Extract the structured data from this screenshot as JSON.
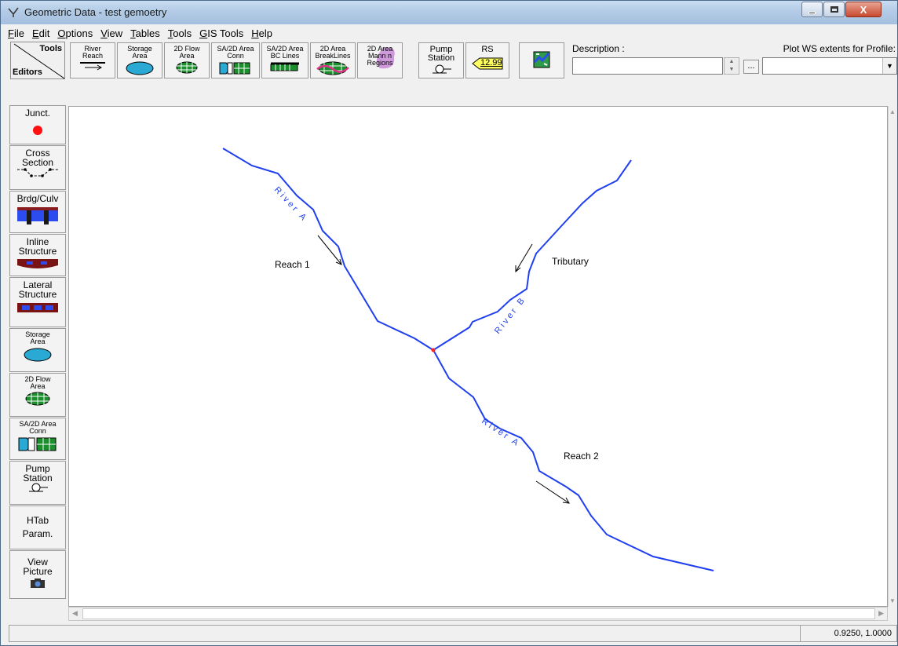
{
  "window": {
    "title": "Geometric Data - test gemoetry",
    "close_glyph": "X"
  },
  "menu": [
    {
      "label": "File"
    },
    {
      "label": "Edit"
    },
    {
      "label": "Options"
    },
    {
      "label": "View"
    },
    {
      "label": "Tables"
    },
    {
      "label": "Tools"
    },
    {
      "label": "GIS Tools"
    },
    {
      "label": "Help"
    }
  ],
  "toolbar": {
    "corner_tools": "Tools",
    "corner_editors": "Editors",
    "river_reach": "River\nReach",
    "storage_area": "Storage\nArea",
    "flow_area_2d": "2D Flow\nArea",
    "sa2d_conn": "SA/2D Area\nConn",
    "sa2d_bc": "SA/2D Area\nBC Lines",
    "breaklines_2d": "2D Area\nBreakLines",
    "mann_regions_2d": "2D Area\nMann n\nRegions",
    "pump_station": "Pump\nStation",
    "rs": "RS",
    "rs_value": "12.99",
    "description_label": "Description :",
    "description_value": "",
    "ellipsis": "...",
    "plot_ws_label": "Plot WS extents for Profile:",
    "plot_ws_value": ""
  },
  "editors": [
    {
      "label": "Junct.",
      "icon": "junction-dot-icon"
    },
    {
      "label": "Cross\nSection",
      "icon": "cross-section-icon"
    },
    {
      "label": "Brdg/Culv",
      "icon": "bridge-icon"
    },
    {
      "label": "Inline\nStructure",
      "icon": "inline-structure-icon"
    },
    {
      "label": "Lateral\nStructure",
      "icon": "lateral-structure-icon"
    },
    {
      "label": "Storage\nArea",
      "icon": "storage-area-icon"
    },
    {
      "label": "2D Flow\nArea",
      "icon": "flow-area-2d-icon"
    },
    {
      "label": "SA/2D Area\nConn",
      "icon": "sa2d-conn-icon"
    },
    {
      "label": "Pump\nStation",
      "icon": "pump-station-icon"
    },
    {
      "label": "HTab\nParam.",
      "icon": ""
    },
    {
      "label": "View\nPicture",
      "icon": "camera-icon"
    }
  ],
  "schematic": {
    "labels": {
      "reach1": "Reach 1",
      "reach2": "Reach 2",
      "tributary": "Tributary",
      "river_a_upper": "River A",
      "river_a_lower": "River A",
      "river_b": "River B"
    },
    "colors": {
      "river": "#1f3ff0",
      "junction": "#ff2020"
    }
  },
  "status": {
    "coords": "0.9250, 1.0000"
  }
}
